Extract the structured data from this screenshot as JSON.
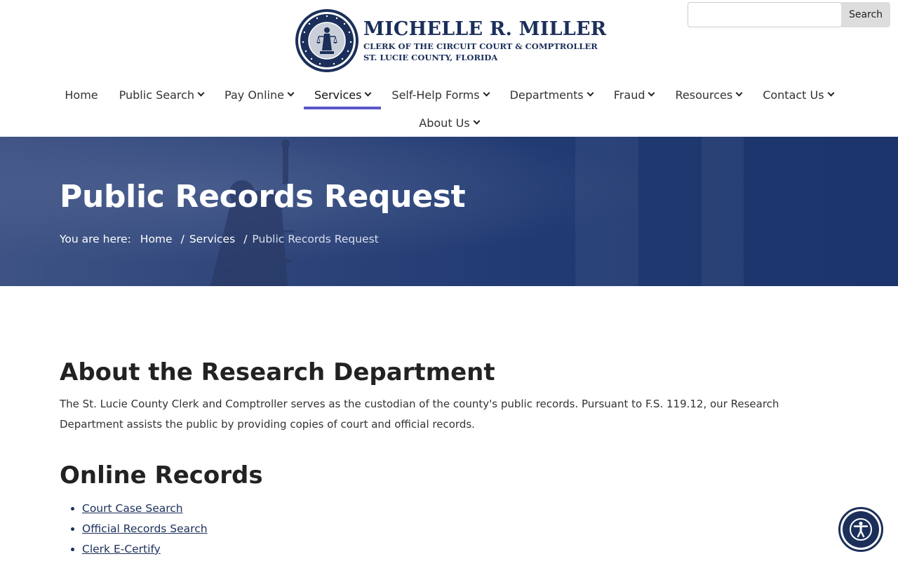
{
  "header": {
    "logo_name": "MICHELLE R. MILLER",
    "logo_line2": "CLERK OF THE CIRCUIT COURT & COMPTROLLER",
    "logo_line3": "ST. LUCIE COUNTY, FLORIDA",
    "logo_icon": "county-seal-icon"
  },
  "search": {
    "placeholder": "",
    "value": "",
    "button_label": "Search"
  },
  "nav": {
    "row1": [
      {
        "label": "Home",
        "dropdown": false
      },
      {
        "label": "Public Search",
        "dropdown": true
      },
      {
        "label": "Pay Online",
        "dropdown": true
      },
      {
        "label": "Services",
        "dropdown": true,
        "active": true
      },
      {
        "label": "Self-Help Forms",
        "dropdown": true
      },
      {
        "label": "Departments",
        "dropdown": true
      },
      {
        "label": "Fraud",
        "dropdown": true
      },
      {
        "label": "Resources",
        "dropdown": true
      },
      {
        "label": "Contact Us",
        "dropdown": true
      }
    ],
    "row2": [
      {
        "label": "About Us",
        "dropdown": true
      }
    ],
    "active_color": "#5b56c8"
  },
  "hero": {
    "title": "Public Records Request",
    "breadcrumb_lead": "You are here:",
    "breadcrumb": [
      "Home",
      "Services",
      "Public Records Request"
    ],
    "separator": "/"
  },
  "main": {
    "section1_title": "About the Research Department",
    "section1_text": "The St. Lucie County Clerk and Comptroller serves as the custodian of the county's public records. Pursuant to F.S. 119.12, our Research Department assists the public by providing copies of court and official records.",
    "section2_title": "Online Records",
    "links": [
      "Court Case Search",
      "Official Records Search",
      "Clerk E-Certify"
    ]
  },
  "accessibility": {
    "icon": "accessibility-icon"
  },
  "colors": {
    "brand_navy": "#1b2f5a",
    "hero_blue": "#203a72"
  }
}
